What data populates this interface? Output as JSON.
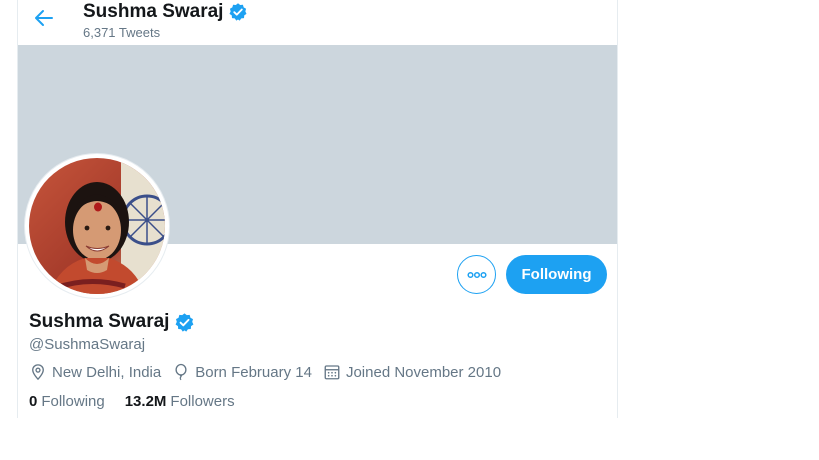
{
  "header": {
    "name": "Sushma Swaraj",
    "tweet_count": "6,371 Tweets"
  },
  "profile": {
    "name": "Sushma Swaraj",
    "handle": "@SushmaSwaraj",
    "location": "New Delhi, India",
    "birthday": "Born February 14",
    "joined": "Joined November 2010",
    "following_count": "0",
    "following_label": "Following",
    "followers_count": "13.2M",
    "followers_label": "Followers"
  },
  "actions": {
    "follow_button_label": "Following"
  },
  "icons": {
    "back": "arrow-left-icon",
    "verified": "verified-badge-icon",
    "more": "more-horizontal-icon",
    "location": "location-pin-icon",
    "birthday": "balloon-icon",
    "joined": "calendar-icon"
  },
  "colors": {
    "accent": "#1da1f2",
    "banner": "#ccd6dd",
    "secondary_text": "#657786",
    "primary_text": "#14171a"
  }
}
